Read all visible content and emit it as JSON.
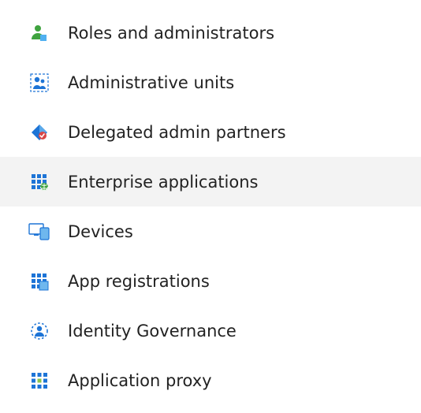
{
  "sidebar": {
    "items": [
      {
        "label": "Roles and administrators",
        "selected": false
      },
      {
        "label": "Administrative units",
        "selected": false
      },
      {
        "label": "Delegated admin partners",
        "selected": false
      },
      {
        "label": "Enterprise applications",
        "selected": true
      },
      {
        "label": "Devices",
        "selected": false
      },
      {
        "label": "App registrations",
        "selected": false
      },
      {
        "label": "Identity Governance",
        "selected": false
      },
      {
        "label": "Application proxy",
        "selected": false
      }
    ]
  }
}
